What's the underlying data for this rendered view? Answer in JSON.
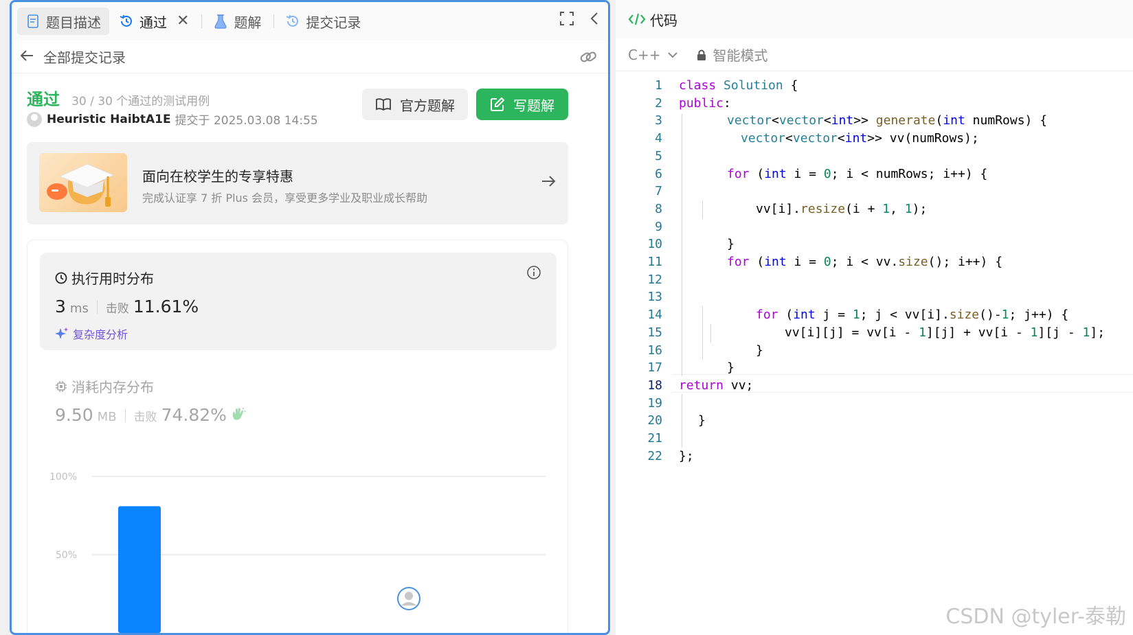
{
  "tabs": {
    "description": "题目描述",
    "passed": "通过",
    "solutions": "题解",
    "submissions": "提交记录"
  },
  "subheader": {
    "title": "全部提交记录"
  },
  "status": {
    "result": "通过",
    "cases": "30 / 30 个通过的测试用例",
    "user": "Heuristic HaibtA1E",
    "submitted": "提交于 2025.03.08 14:55"
  },
  "buttons": {
    "official": "官方题解",
    "write": "写题解"
  },
  "promo": {
    "title": "面向在校学生的专享特惠",
    "subtitle": "完成认证享 7 折 Plus 会员，享受更多学业及职业成长帮助"
  },
  "runtime": {
    "title": "执行用时分布",
    "value": "3",
    "unit": "ms",
    "beat_label": "击败",
    "beat": "11.61%",
    "analysis": "复杂度分析"
  },
  "memory": {
    "title": "消耗内存分布",
    "value": "9.50",
    "unit": "MB",
    "beat_label": "击败",
    "beat": "74.82%"
  },
  "chart_data": {
    "type": "bar",
    "yticks": [
      "100%",
      "50%"
    ],
    "ylim": [
      0,
      100
    ],
    "categories": [
      "",
      ""
    ],
    "values": [
      81,
      0
    ],
    "bar_color": "#0a84ff"
  },
  "code_panel": {
    "title": "代码",
    "language": "C++",
    "mode": "智能模式"
  },
  "code_lines": [
    "class Solution {",
    "public:",
    "vector<vector<int>> generate(int numRows) {",
    "vector<vector<int>> vv(numRows);",
    "",
    "for (int i = 0; i < numRows; i++) {",
    "",
    "vv[i].resize(i + 1, 1);",
    "",
    "}",
    "for (int i = 0; i < vv.size(); i++) {",
    "",
    "",
    "for (int j = 1; j < vv[i].size()-1; j++) {",
    "vv[i][j] = vv[i - 1][j] + vv[i - 1][j - 1];",
    "}",
    "}",
    "return vv;",
    "",
    "}",
    "",
    "};"
  ],
  "watermark": "CSDN @tyler-泰勒",
  "colors": {
    "accent_green": "#2db55d",
    "accent_blue": "#0a84ff",
    "panel_border": "#4a90e2"
  }
}
